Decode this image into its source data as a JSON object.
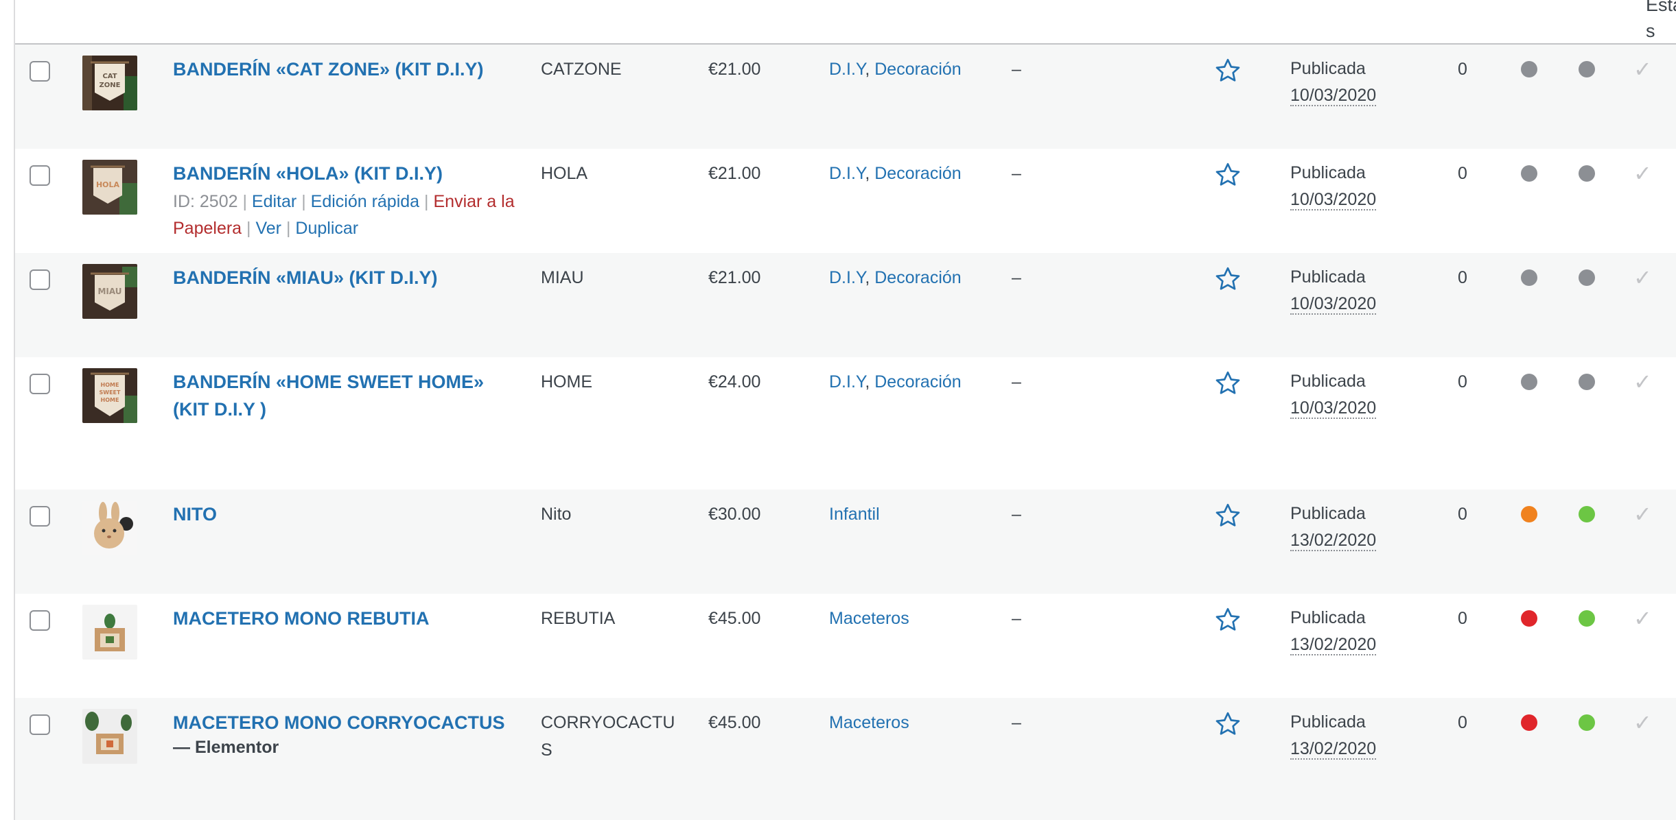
{
  "header": {
    "fragment": "Estado\ns"
  },
  "products": [
    {
      "title": "BANDERÍN «CAT ZONE» (KIT D.I.Y)",
      "sku": "CATZONE",
      "price": "€21.00",
      "categories": [
        "D.I.Y",
        "Decoración"
      ],
      "tags": "–",
      "status": "Publicada",
      "date": "10/03/2020",
      "count": "0",
      "thumb_icon": "cat-zone-banner-thumbnail",
      "thumb_text": "CAT ZONE",
      "dot1_color": "#8c8f94",
      "dot2_color": "#8c8f94"
    },
    {
      "title": "BANDERÍN «HOLA» (KIT D.I.Y)",
      "sku": "HOLA",
      "price": "€21.00",
      "categories": [
        "D.I.Y",
        "Decoración"
      ],
      "tags": "–",
      "status": "Publicada",
      "date": "10/03/2020",
      "count": "0",
      "thumb_icon": "hola-banner-thumbnail",
      "thumb_text": "HOLA",
      "dot1_color": "#8c8f94",
      "dot2_color": "#8c8f94",
      "row_actions": {
        "id": "ID: 2502",
        "edit": "Editar",
        "quick_edit": "Edición rápida",
        "trash": "Enviar a la Papelera",
        "view": "Ver",
        "duplicate": "Duplicar"
      }
    },
    {
      "title": "BANDERÍN «MIAU» (KIT D.I.Y)",
      "sku": "MIAU",
      "price": "€21.00",
      "categories": [
        "D.I.Y",
        "Decoración"
      ],
      "tags": "–",
      "status": "Publicada",
      "date": "10/03/2020",
      "count": "0",
      "thumb_icon": "miau-banner-thumbnail",
      "thumb_text": "MIAU",
      "dot1_color": "#8c8f94",
      "dot2_color": "#8c8f94"
    },
    {
      "title": "BANDERÍN «HOME SWEET HOME» (KIT D.I.Y )",
      "sku": "HOME",
      "price": "€24.00",
      "categories": [
        "D.I.Y",
        "Decoración"
      ],
      "tags": "–",
      "status": "Publicada",
      "date": "10/03/2020",
      "count": "0",
      "thumb_icon": "home-sweet-home-banner-thumbnail",
      "thumb_text": "HOME SWEET HOME",
      "dot1_color": "#8c8f94",
      "dot2_color": "#8c8f94"
    },
    {
      "title": "NITO",
      "sku": "Nito",
      "price": "€30.00",
      "categories": [
        "Infantil"
      ],
      "tags": "–",
      "status": "Publicada",
      "date": "13/02/2020",
      "count": "0",
      "thumb_icon": "bunny-plate-thumbnail",
      "dot1_color": "#f0821e",
      "dot2_color": "#6cc644"
    },
    {
      "title": "MACETERO MONO REBUTIA",
      "sku": "REBUTIA",
      "price": "€45.00",
      "categories": [
        "Maceteros"
      ],
      "tags": "–",
      "status": "Publicada",
      "date": "13/02/2020",
      "count": "0",
      "thumb_icon": "planter-rebutia-thumbnail",
      "dot1_color": "#e0262b",
      "dot2_color": "#6cc644"
    },
    {
      "title": "MACETERO MONO CORRYOCACTUS",
      "sku": "CORRYOCACTUS",
      "price": "€45.00",
      "categories": [
        "Maceteros"
      ],
      "tags": "–",
      "status": "Publicada",
      "date": "13/02/2020",
      "count": "0",
      "thumb_icon": "planter-corryocactus-thumbnail",
      "post_state": "— Elementor",
      "dot1_color": "#e0262b",
      "dot2_color": "#6cc644"
    }
  ]
}
